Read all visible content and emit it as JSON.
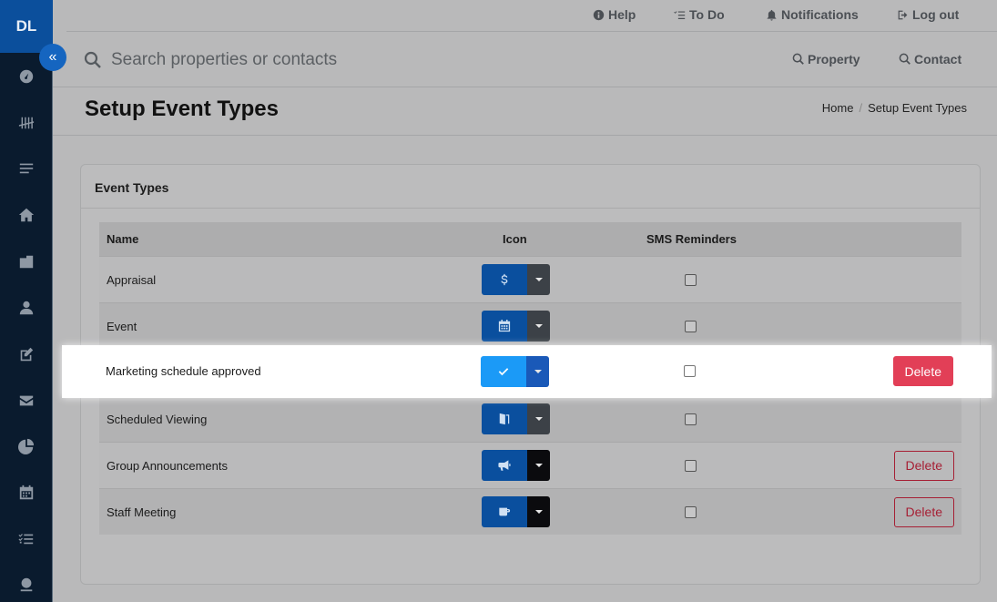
{
  "sidebar": {
    "logo": "DL",
    "collapse_icon": "chevrons-left-icon",
    "items": [
      {
        "name": "dashboard-icon"
      },
      {
        "name": "tally-icon"
      },
      {
        "name": "list-icon"
      },
      {
        "name": "home-icon"
      },
      {
        "name": "building-icon"
      },
      {
        "name": "user-icon"
      },
      {
        "name": "edit-icon"
      },
      {
        "name": "envelope-icon"
      },
      {
        "name": "pie-chart-icon"
      },
      {
        "name": "calendar-icon"
      },
      {
        "name": "task-list-icon"
      },
      {
        "name": "money-icon"
      }
    ]
  },
  "topbar": {
    "help": "Help",
    "todo": "To Do",
    "notifications": "Notifications",
    "logout": "Log out"
  },
  "search": {
    "placeholder": "Search properties or contacts",
    "property": "Property",
    "contact": "Contact"
  },
  "header": {
    "title": "Setup Event Types",
    "breadcrumb_home": "Home",
    "breadcrumb_sep": "/",
    "breadcrumb_current": "Setup Event Types"
  },
  "card": {
    "title": "Event Types",
    "columns": {
      "name": "Name",
      "icon": "Icon",
      "sms": "SMS Reminders"
    },
    "rows": [
      {
        "name": "Appraisal",
        "icon": "dollar-icon",
        "sms": false,
        "delete": ""
      },
      {
        "name": "Event",
        "icon": "calendar-icon",
        "sms": false,
        "delete": ""
      },
      {
        "name": "Marketing schedule approved",
        "icon": "check-icon",
        "sms": false,
        "delete": "Delete"
      },
      {
        "name": "Scheduled Viewing",
        "icon": "door-icon",
        "sms": false,
        "delete": ""
      },
      {
        "name": "Group Announcements",
        "icon": "megaphone-icon",
        "sms": false,
        "delete": "Delete"
      },
      {
        "name": "Staff Meeting",
        "icon": "coffee-icon",
        "sms": false,
        "delete": "Delete"
      }
    ]
  },
  "colors": {
    "sidebar_bg": "#0a1b2e",
    "brand": "#0b4f9c",
    "icon_btn": "#0a4f9e",
    "icon_btn_active": "#1b9af7",
    "delete": "#e23f57"
  }
}
